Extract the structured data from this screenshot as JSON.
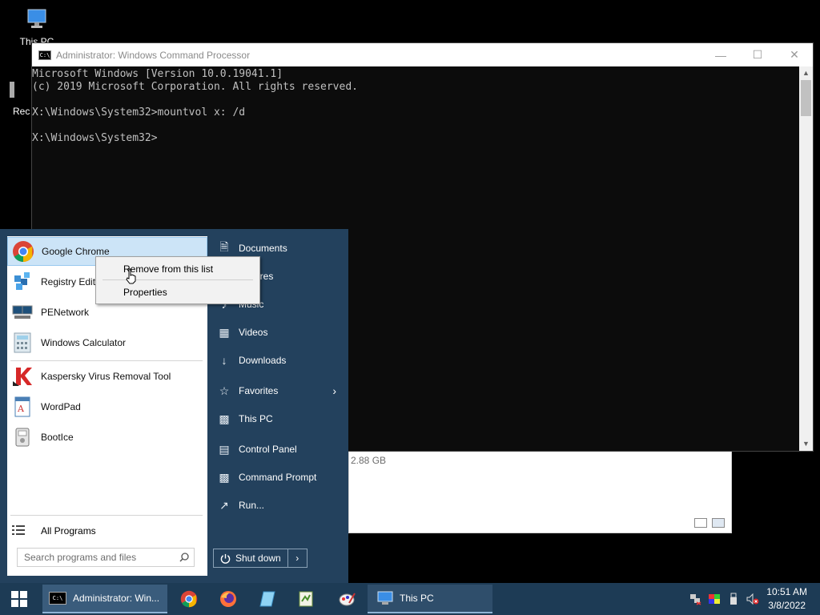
{
  "desktop": {
    "icons": [
      {
        "label": "This PC",
        "icon": "this-pc-icon"
      },
      {
        "label": "Rec",
        "icon": "recycle-bin-icon"
      }
    ]
  },
  "explorer": {
    "size_text": "2.88 GB"
  },
  "cmd": {
    "title": "Administrator: Windows Command Processor",
    "lines": [
      "Microsoft Windows [Version 10.0.19041.1]",
      "(c) 2019 Microsoft Corporation. All rights reserved.",
      "",
      "X:\\Windows\\System32>mountvol x: /d",
      "",
      "X:\\Windows\\System32>"
    ]
  },
  "start_menu": {
    "programs": [
      {
        "label": "Google Chrome",
        "icon": "chrome-icon"
      },
      {
        "label": "Registry Editor",
        "icon": "registry-editor-icon"
      },
      {
        "label": "PENetwork",
        "icon": "penetwork-icon"
      },
      {
        "label": "Windows Calculator",
        "icon": "calculator-icon"
      },
      {
        "label": "Kaspersky Virus Removal Tool",
        "icon": "kaspersky-icon"
      },
      {
        "label": "WordPad",
        "icon": "wordpad-icon"
      },
      {
        "label": "BootIce",
        "icon": "bootice-icon"
      }
    ],
    "all_programs": "All Programs",
    "search_placeholder": "Search programs and files",
    "places": [
      {
        "label": "Documents",
        "icon": "documents-icon"
      },
      {
        "label": "Pictures",
        "icon": "pictures-icon"
      },
      {
        "label": "Music",
        "icon": "music-icon"
      },
      {
        "label": "Videos",
        "icon": "videos-icon"
      },
      {
        "label": "Downloads",
        "icon": "downloads-icon"
      },
      {
        "label": "Favorites",
        "icon": "star-icon"
      },
      {
        "label": "This PC",
        "icon": "computer-icon"
      },
      {
        "label": "Control Panel",
        "icon": "control-panel-icon"
      },
      {
        "label": "Command Prompt",
        "icon": "command-prompt-icon"
      },
      {
        "label": "Run...",
        "icon": "run-icon"
      }
    ],
    "shutdown": "Shut down"
  },
  "context_menu": {
    "items": [
      "Remove from this list",
      "Properties"
    ]
  },
  "taskbar": {
    "items": [
      {
        "label": "Administrator: Win...",
        "icon": "cmd-icon"
      },
      {
        "label": "This PC",
        "icon": "this-pc-icon"
      }
    ],
    "pinned": [
      "chrome-icon",
      "firefox-icon",
      "notepad-icon",
      "editor-icon",
      "paint-icon"
    ],
    "clock": {
      "time": "10:51 AM",
      "date": "3/8/2022"
    }
  }
}
